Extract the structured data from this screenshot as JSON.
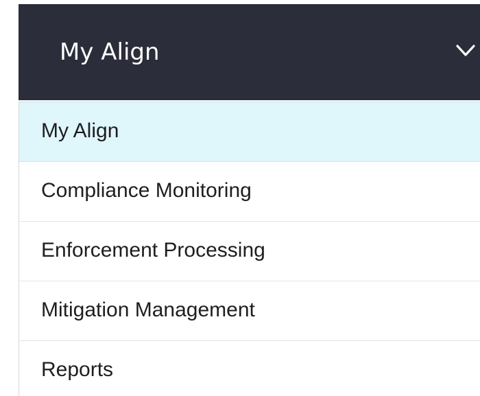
{
  "dropdown": {
    "selected_label": "My Align",
    "toggle_icon": "chevron-down-icon",
    "header_bg": "#2b2d3a",
    "active_bg": "#dff6fb"
  },
  "menu": {
    "items": [
      {
        "label": "My Align",
        "active": true
      },
      {
        "label": "Compliance Monitoring",
        "active": false
      },
      {
        "label": "Enforcement Processing",
        "active": false
      },
      {
        "label": "Mitigation Management",
        "active": false
      },
      {
        "label": "Reports",
        "active": false
      }
    ]
  }
}
